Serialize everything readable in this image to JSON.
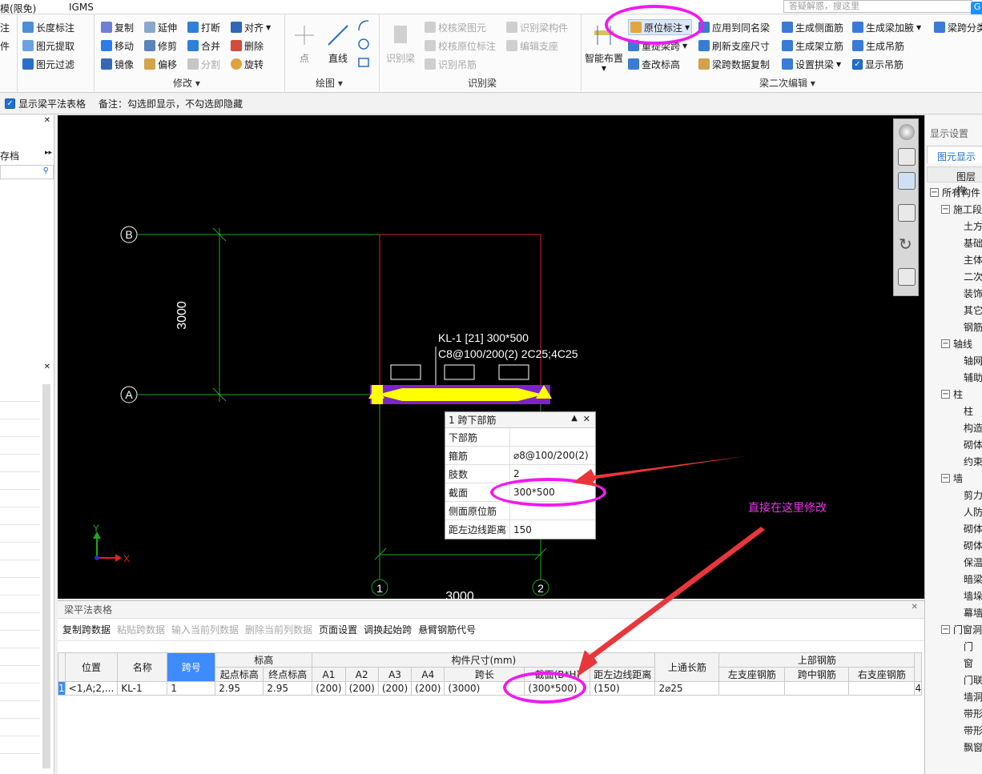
{
  "menu": {
    "left_item": "模(限免)",
    "igms": "IGMS"
  },
  "search": {
    "placeholder": "答疑解惑，搜这里"
  },
  "ribbon": {
    "g0": {
      "items": [
        "注",
        "件",
        ""
      ]
    },
    "g1": {
      "items": [
        "长度标注",
        "图元提取",
        "图元过滤"
      ]
    },
    "modify": {
      "title": "修改",
      "col1": [
        "复制",
        "移动",
        "镜像"
      ],
      "col2": [
        "延伸",
        "修剪",
        "偏移"
      ],
      "col3": [
        "打断",
        "合并",
        "分割"
      ],
      "col4": [
        "对齐",
        "删除",
        "旋转"
      ]
    },
    "draw": {
      "title": "绘图",
      "point": "点",
      "line": "直线"
    },
    "identify": {
      "title": "识别梁",
      "big": "识别梁",
      "col1": [
        "校核梁图元",
        "校核原位标注",
        "识别吊筋"
      ],
      "col2": [
        "识别梁构件",
        "编辑支座"
      ]
    },
    "beam_edit": {
      "title": "梁二次编辑",
      "smart": "智能布置",
      "col1": [
        "原位标注",
        "重提梁跨",
        "查改标高"
      ],
      "col2": [
        "应用到同名梁",
        "刷新支座尺寸",
        "梁跨数据复制"
      ],
      "col3": [
        "生成侧面筋",
        "生成架立筋",
        "设置拱梁"
      ],
      "col4": [
        "生成梁加腋",
        "生成吊筋",
        "显示吊筋"
      ],
      "col5": [
        "梁跨分类"
      ]
    }
  },
  "option_bar": {
    "checkbox_label": "显示梁平法表格",
    "note": "备注：勾选即显示，不勾选即隐藏"
  },
  "left_panel": {
    "top_label": "存档"
  },
  "canvas": {
    "axis_b": "B",
    "axis_a": "A",
    "axis_1": "1",
    "axis_2": "2",
    "dim_vertical": "3000",
    "dim_horizontal": "3000",
    "beam_label_1": "KL-1 [21] 300*500",
    "beam_label_2": "C8@100/200(2) 2C25;4C25",
    "ucs_y": "Y",
    "ucs_x": "X"
  },
  "popup": {
    "title": "1 跨下部筋",
    "rows": [
      {
        "k": "下部筋",
        "v": ""
      },
      {
        "k": "箍筋",
        "v": "⌀8@100/200(2)"
      },
      {
        "k": "肢数",
        "v": "2"
      },
      {
        "k": "截面",
        "v": "300*500"
      },
      {
        "k": "侧面原位筋",
        "v": ""
      },
      {
        "k": "距左边线距离",
        "v": "150"
      }
    ]
  },
  "annotation": {
    "text": "直接在这里修改"
  },
  "right_panel": {
    "title": "显示设置",
    "tab": "图元显示",
    "col_header": "图层构",
    "tree": [
      {
        "t": "所有构件",
        "lv": 0,
        "box": "−"
      },
      {
        "t": "施工段",
        "lv": 1,
        "box": "−"
      },
      {
        "t": "土方工",
        "lv": 2
      },
      {
        "t": "基础工",
        "lv": 2
      },
      {
        "t": "主体结",
        "lv": 2
      },
      {
        "t": "二次结",
        "lv": 2
      },
      {
        "t": "装饰装",
        "lv": 2
      },
      {
        "t": "其它土",
        "lv": 2
      },
      {
        "t": "钢筋工",
        "lv": 2
      },
      {
        "t": "轴线",
        "lv": 1,
        "box": "−"
      },
      {
        "t": "轴网",
        "lv": 2
      },
      {
        "t": "辅助轴",
        "lv": 2
      },
      {
        "t": "柱",
        "lv": 1,
        "box": "−"
      },
      {
        "t": "柱",
        "lv": 2
      },
      {
        "t": "构造柱",
        "lv": 2
      },
      {
        "t": "砌体柱",
        "lv": 2
      },
      {
        "t": "约束边",
        "lv": 2
      },
      {
        "t": "墙",
        "lv": 1,
        "box": "−"
      },
      {
        "t": "剪力墙",
        "lv": 2
      },
      {
        "t": "人防门",
        "lv": 2
      },
      {
        "t": "砌体墙",
        "lv": 2
      },
      {
        "t": "砌体加",
        "lv": 2
      },
      {
        "t": "保温墙",
        "lv": 2
      },
      {
        "t": "暗梁",
        "lv": 2
      },
      {
        "t": "墙垛",
        "lv": 2
      },
      {
        "t": "幕墙",
        "lv": 2
      },
      {
        "t": "门窗洞",
        "lv": 1,
        "box": "−"
      },
      {
        "t": "门",
        "lv": 2
      },
      {
        "t": "窗",
        "lv": 2
      },
      {
        "t": "门联窗",
        "lv": 2
      },
      {
        "t": "墙洞",
        "lv": 2
      },
      {
        "t": "带形窗",
        "lv": 2
      },
      {
        "t": "带形洞",
        "lv": 2
      },
      {
        "t": "飘窗",
        "lv": 2
      }
    ]
  },
  "bottom_panel": {
    "title": "梁平法表格",
    "toolbar": [
      {
        "label": "复制跨数据",
        "enabled": true
      },
      {
        "label": "粘贴跨数据",
        "enabled": false
      },
      {
        "label": "输入当前列数据",
        "enabled": false
      },
      {
        "label": "删除当前列数据",
        "enabled": false
      },
      {
        "label": "页面设置",
        "enabled": true
      },
      {
        "label": "调换起始跨",
        "enabled": true
      },
      {
        "label": "悬臂钢筋代号",
        "enabled": true
      }
    ],
    "table": {
      "h_position": "位置",
      "h_name": "名称",
      "h_span": "跨号",
      "h_elev": "标高",
      "h_start_elev": "起点标高",
      "h_end_elev": "终点标高",
      "h_size": "构件尺寸(mm)",
      "h_a1": "A1",
      "h_a2": "A2",
      "h_a3": "A3",
      "h_a4": "A4",
      "h_span_len": "跨长",
      "h_section": "截面(B*H)",
      "h_left_dist": "距左边线距离",
      "h_top_through": "上通长筋",
      "h_top_bar": "上部钢筋",
      "h_left_support": "左支座钢筋",
      "h_mid": "跨中钢筋",
      "h_right_support": "右支座钢筋",
      "row": {
        "idx": "1",
        "position": "<1,A;2,...",
        "name": "KL-1",
        "span": "1",
        "start_elev": "2.95",
        "end_elev": "2.95",
        "a1": "(200)",
        "a2": "(200)",
        "a3": "(200)",
        "a4": "(200)",
        "span_len": "(3000)",
        "section": "(300*500)",
        "left_dist": "(150)",
        "top_through": "2⌀25",
        "left_support": "",
        "mid": "",
        "right_support": "",
        "extra": "4"
      }
    }
  },
  "colors": {
    "annotation": "#ee1bee",
    "arrow": "#e8363b",
    "beam": "#ffff00",
    "axis": "#1fa61f",
    "accent": "#1d6fd6"
  }
}
